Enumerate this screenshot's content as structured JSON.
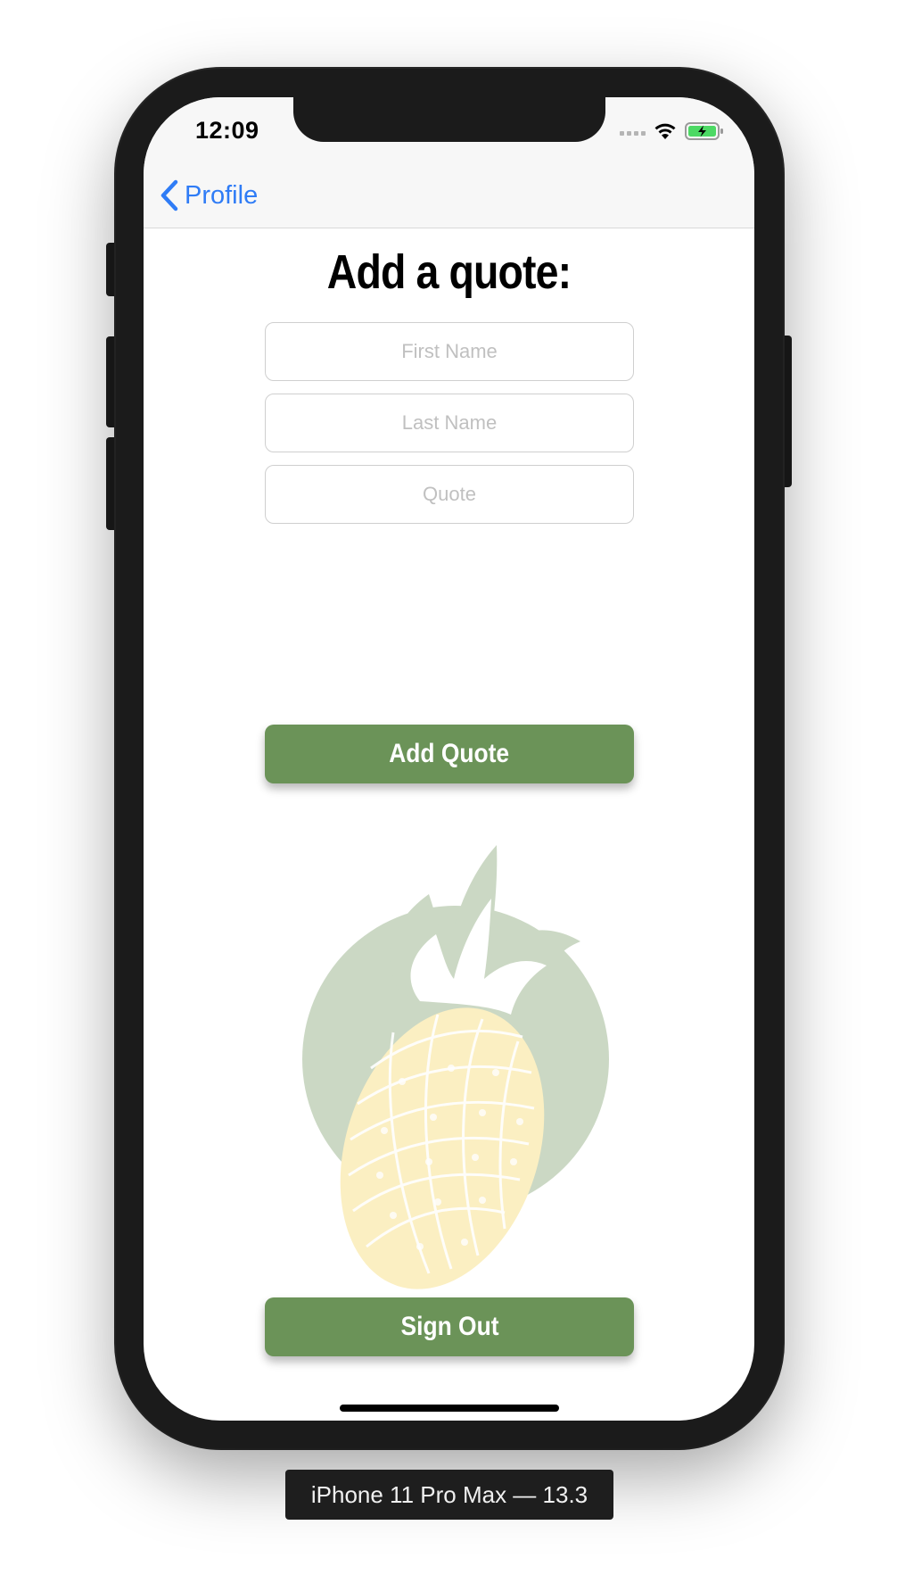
{
  "status_bar": {
    "time": "12:09"
  },
  "nav": {
    "back_label": "Profile"
  },
  "page": {
    "title": "Add a quote:"
  },
  "form": {
    "first_name": {
      "value": "",
      "placeholder": "First Name"
    },
    "last_name": {
      "value": "",
      "placeholder": "Last Name"
    },
    "quote": {
      "value": "",
      "placeholder": "Quote"
    }
  },
  "buttons": {
    "add_quote": "Add Quote",
    "sign_out": "Sign Out"
  },
  "device": {
    "label": "iPhone 11 Pro Max — 13.3"
  },
  "colors": {
    "accent_green": "#6b9358",
    "ios_blue": "#2f7cf6",
    "battery_green": "#4cd964",
    "pineapple_circle": "#cbd8c4",
    "pineapple_body": "#fbefc2"
  },
  "icons": {
    "back": "chevron-left-icon",
    "signal": "cellular-signal-icon",
    "wifi": "wifi-icon",
    "battery": "battery-charging-icon",
    "illustration": "pineapple-icon"
  }
}
